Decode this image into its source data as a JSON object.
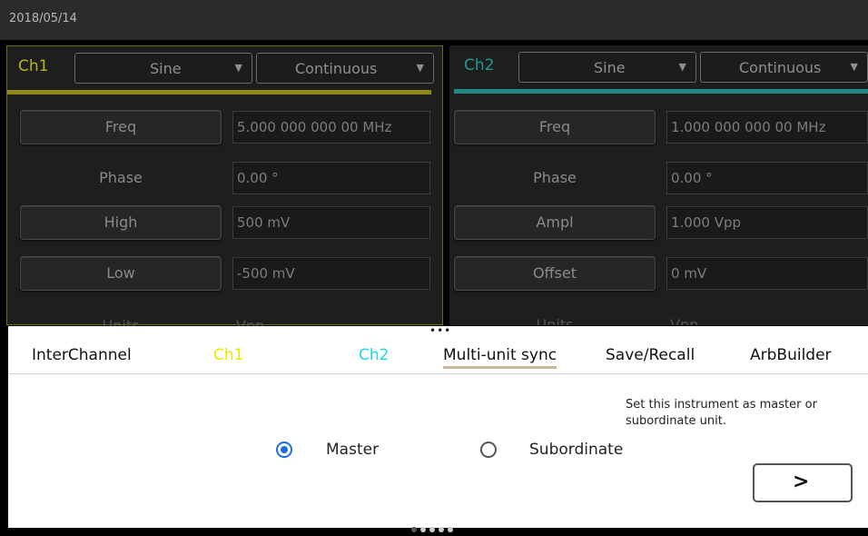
{
  "date": "2018/05/14",
  "ch1": {
    "label": "Ch1",
    "waveform": "Sine",
    "mode": "Continuous",
    "accent": "#8c8a14",
    "rows": [
      {
        "name": "Freq",
        "value": "5.000 000 000 00 MHz"
      },
      {
        "name": "Phase",
        "value": "0.00 °"
      },
      {
        "name": "High",
        "value": "500 mV"
      },
      {
        "name": "Low",
        "value": "-500 mV"
      },
      {
        "name": "Units",
        "value": "Vpp"
      }
    ]
  },
  "ch2": {
    "label": "Ch2",
    "waveform": "Sine",
    "mode": "Continuous",
    "accent": "#1f8a85",
    "rows": [
      {
        "name": "Freq",
        "value": "1.000 000 000 00 MHz"
      },
      {
        "name": "Phase",
        "value": "0.00 °"
      },
      {
        "name": "Ampl",
        "value": "1.000 Vpp"
      },
      {
        "name": "Offset",
        "value": "0 mV"
      },
      {
        "name": "Units",
        "value": "Vpp"
      }
    ]
  },
  "tabs": [
    {
      "label": "InterChannel",
      "color": "#111111"
    },
    {
      "label": "Ch1",
      "color": "#e8e800"
    },
    {
      "label": "Ch2",
      "color": "#1ed6e6"
    },
    {
      "label": "Multi-unit sync",
      "color": "#111111"
    },
    {
      "label": "Save/Recall",
      "color": "#111111"
    },
    {
      "label": "ArbBuilder",
      "color": "#111111"
    }
  ],
  "help_text": "Set this instrument as master or subordinate unit.",
  "options": {
    "master": "Master",
    "subordinate": "Subordinate",
    "selected": "Master"
  },
  "next_icon": "chevron-right-icon",
  "next_label": ">",
  "dropdown_icon": "triangle-down-icon",
  "dropdown_glyph": "▼",
  "handle_glyph": "•••",
  "page_indicator": {
    "current": 1,
    "total": 5
  }
}
